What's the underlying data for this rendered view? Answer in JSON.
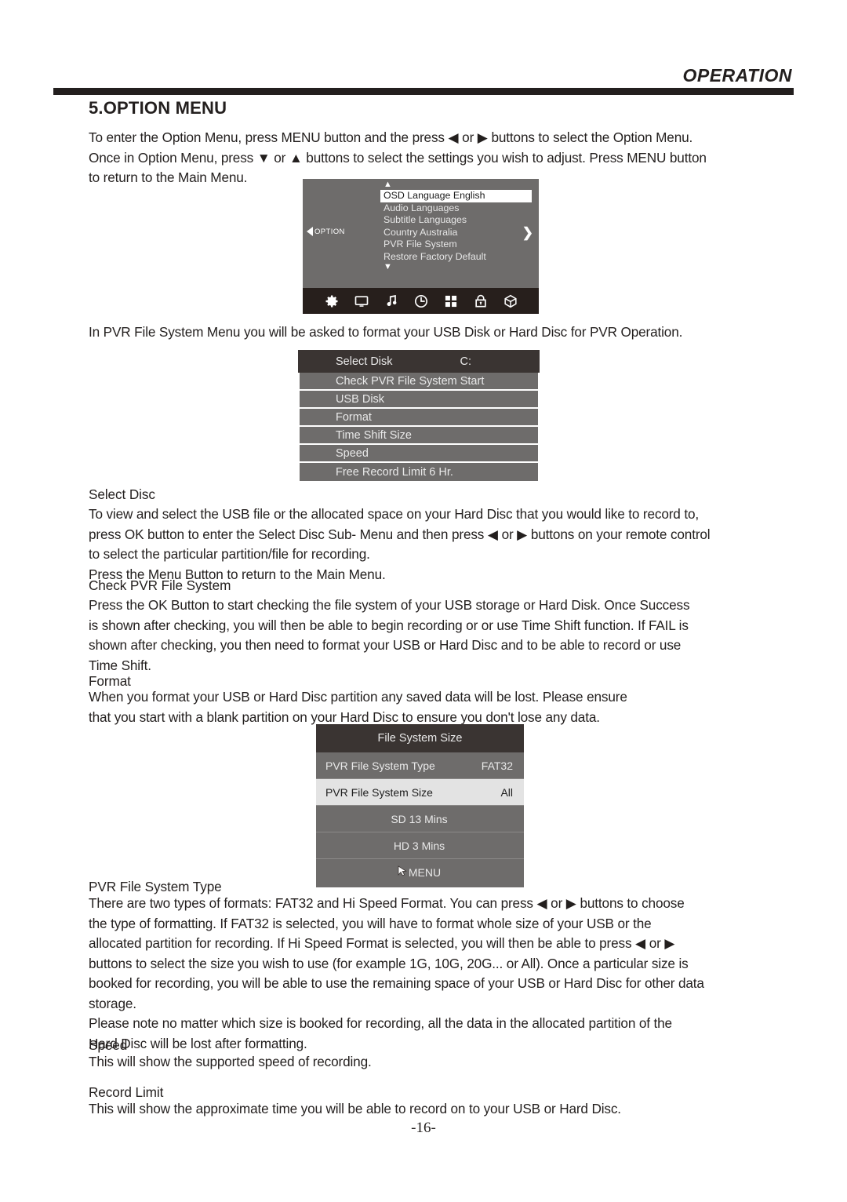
{
  "header": {
    "title": "OPERATION"
  },
  "section": {
    "title": "5.OPTION MENU",
    "intro": "To enter the Option Menu, press MENU button and the press ◀ or ▶ buttons to select the Option Menu.\nOnce in Option Menu, press ▼ or ▲ buttons to select the settings you wish to adjust. Press MENU button\nto return to the Main Menu.",
    "pvr_intro": "In PVR File System Menu  you will be asked to format your USB Disk or Hard Disc for PVR Operation."
  },
  "option_osd": {
    "side_tag": "OPTION",
    "up_caret": "▲",
    "down_caret": "▼",
    "right_arrow": "❯",
    "items": [
      {
        "label": "OSD Language English",
        "selected": true
      },
      {
        "label": "Audio Languages",
        "selected": false
      },
      {
        "label": "Subtitle Languages",
        "selected": false
      },
      {
        "label": "Country Australia",
        "selected": false
      },
      {
        "label": "PVR File System",
        "selected": false
      },
      {
        "label": "Restore Factory Default",
        "selected": false
      }
    ],
    "icons": [
      "gear-icon",
      "monitor-icon",
      "music-note-icon",
      "clock-icon",
      "grid-icon",
      "lock-icon",
      "cube-icon"
    ]
  },
  "pvr_menu": {
    "header": {
      "label": "Select Disk",
      "value": "C:"
    },
    "rows": [
      "Check PVR File System Start",
      "USB Disk",
      "Format",
      "Time Shift Size",
      "Speed",
      "Free Record Limit 6 Hr."
    ]
  },
  "file_system_size": {
    "title": "File System Size",
    "rows": [
      {
        "label": "PVR File System Type",
        "value": "FAT32",
        "highlight": false,
        "center": false
      },
      {
        "label": "PVR File System Size",
        "value": "All",
        "highlight": true,
        "center": false
      },
      {
        "label": "SD 13 Mins",
        "value": "",
        "highlight": false,
        "center": true
      },
      {
        "label": "HD 3 Mins",
        "value": "",
        "highlight": false,
        "center": true
      }
    ],
    "menu_label": "MENU"
  },
  "sections": {
    "select_disc": {
      "heading": "Select Disc",
      "body": "To view and select the USB file or the allocated space on your Hard Disc that you would like to record to,\npress OK button to enter the  Select Disc Sub- Menu and then press ◀ or ▶ buttons on your remote control\nto select the particular partition/file for recording.\nPress the Menu Button to return to the Main Menu."
    },
    "check_pvr": {
      "heading": "Check PVR File System",
      "body": "Press the OK Button to start checking the file system of your USB storage or Hard Disk. Once Success\nis shown after checking, you will then be able to begin recording or or use Time Shift function. If FAIL is\nshown after checking, you then need to format your USB or Hard Disc and to be able to record or use\nTime Shift."
    },
    "format": {
      "heading": "Format",
      "body": "When you format your USB or  Hard Disc partition any saved data will be lost. Please ensure\nthat you start with a blank partition on your Hard Disc to ensure you don't lose any data."
    },
    "pvr_type": {
      "heading": "PVR File System Type",
      "body": "There are two types of formats:  FAT32 and Hi Speed Format.  You can press ◀ or ▶ buttons to choose\nthe type of formatting. If  FAT32 is selected, you will have to format whole size of your USB or the\nallocated partition for recording. If Hi Speed Format is selected, you will then be able to press ◀ or ▶\nbuttons to select the size you wish to use (for example 1G, 10G, 20G... or All). Once a particular size is\nbooked for recording, you will be able to use the remaining space of your USB or Hard Disc for other data\nstorage.\nPlease note no matter which size is booked for recording, all the data in the allocated partition of the\nHard Disc will be lost after formatting."
    },
    "speed": {
      "heading": "Speed",
      "body": "This will show the supported speed of recording."
    },
    "record_limit": {
      "heading": "Record Limit",
      "body": "This will show the approximate time you will be able to record on to  your USB or Hard Disc."
    }
  },
  "page_number": "-16-"
}
